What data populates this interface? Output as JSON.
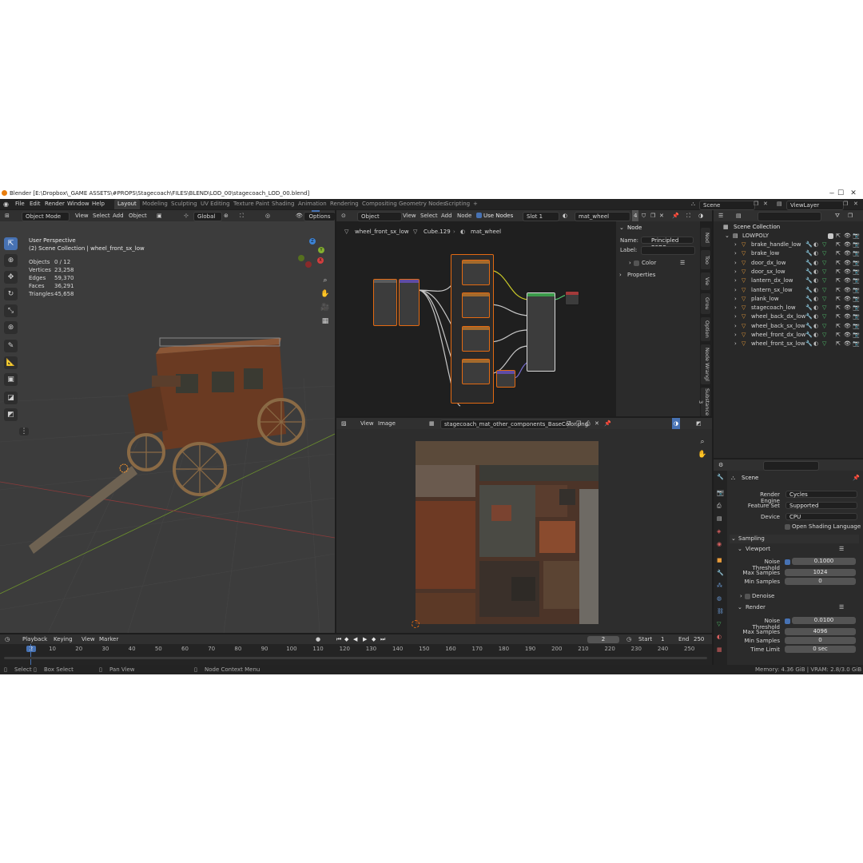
{
  "window": {
    "title": "Blender [E:\\Dropbox\\_GAME ASSETS\\#PROPS\\Stagecoach\\FILES\\BLEND\\LOD_00\\stagecoach_LOD_00.blend]",
    "minimize": "–",
    "maximize": "☐",
    "close": "✕"
  },
  "menu": {
    "items": [
      "File",
      "Edit",
      "Render",
      "Window",
      "Help"
    ],
    "workspaces": [
      "Layout",
      "Modeling",
      "Sculpting",
      "UV Editing",
      "Texture Paint",
      "Shading",
      "Animation",
      "Rendering",
      "Compositing",
      "Geometry Nodes",
      "Scripting"
    ],
    "active_workspace": "Layout",
    "add_workspace": "+",
    "scene": "Scene",
    "view_layer": "ViewLayer"
  },
  "viewport": {
    "mode": "Object Mode",
    "menus": [
      "View",
      "Select",
      "Add",
      "Object"
    ],
    "transform": "Global",
    "options": "Options",
    "view_name": "User Perspective",
    "collection_path": "(2) Scene Collection | wheel_front_sx_low",
    "stats": [
      {
        "label": "Objects",
        "value": "0 / 12"
      },
      {
        "label": "Vertices",
        "value": "23,258"
      },
      {
        "label": "Edges",
        "value": "59,370"
      },
      {
        "label": "Faces",
        "value": "36,291"
      },
      {
        "label": "Triangles",
        "value": "45,658"
      }
    ],
    "gizmo": {
      "x": "X",
      "y": "Y",
      "z": "Z"
    }
  },
  "node_editor": {
    "object_dropdown": "Object",
    "menus": [
      "View",
      "Select",
      "Add",
      "Node"
    ],
    "use_nodes": "Use Nodes",
    "slot": "Slot 1",
    "material": "mat_wheel",
    "user_count": "4",
    "breadcrumbs": [
      "wheel_front_sx_low",
      "Cube.129",
      "mat_wheel"
    ],
    "sidebar": {
      "panel": "Node",
      "name_label": "Name:",
      "name_value": "Principled BSDF",
      "label_label": "Label:",
      "label_value": "",
      "color": "Color",
      "properties": "Properties"
    },
    "vtabs": [
      "Nod",
      "Too",
      "Vie",
      "Grou",
      "Option",
      "Node Wrangl",
      "Substance 3"
    ]
  },
  "image_editor": {
    "menus": [
      "View",
      "Image"
    ],
    "image_name": "stagecoach_mat_other_components_BaseColor.png"
  },
  "outliner": {
    "root": "Scene Collection",
    "collection": "LOWPOLY",
    "items": [
      "brake_handle_low",
      "brake_low",
      "door_dx_low",
      "door_sx_low",
      "lantern_dx_low",
      "lantern_sx_low",
      "plank_low",
      "stagecoach_low",
      "wheel_back_dx_low",
      "wheel_back_sx_low",
      "wheel_front_dx_low",
      "wheel_front_sx_low"
    ]
  },
  "properties": {
    "scene": "Scene",
    "render_engine_label": "Render Engine",
    "render_engine": "Cycles",
    "feature_set_label": "Feature Set",
    "feature_set": "Supported",
    "device_label": "Device",
    "device": "CPU",
    "osl": "Open Shading Language",
    "sampling": "Sampling",
    "viewport": "Viewport",
    "vp_noise_label": "Noise Threshold",
    "vp_noise": "0.1000",
    "vp_max_label": "Max Samples",
    "vp_max": "1024",
    "vp_min_label": "Min Samples",
    "vp_min": "0",
    "denoise": "Denoise",
    "render": "Render",
    "r_noise_label": "Noise Threshold",
    "r_noise": "0.0100",
    "r_max_label": "Max Samples",
    "r_max": "4096",
    "r_min_label": "Min Samples",
    "r_min": "0",
    "time_limit_label": "Time Limit",
    "time_limit": "0 sec"
  },
  "timeline": {
    "menus": [
      "Playback",
      "Keying",
      "View",
      "Marker"
    ],
    "current_frame": "2",
    "start_label": "Start",
    "start": "1",
    "end_label": "End",
    "end": "250",
    "ticks": [
      "2",
      "10",
      "20",
      "30",
      "40",
      "50",
      "60",
      "70",
      "80",
      "90",
      "100",
      "110",
      "120",
      "130",
      "140",
      "150",
      "160",
      "170",
      "180",
      "190",
      "200",
      "210",
      "220",
      "230",
      "240",
      "250"
    ]
  },
  "statusbar": {
    "select": "Select",
    "box_select": "Box Select",
    "pan_view": "Pan View",
    "node_context": "Node Context Menu",
    "memory": "Memory: 4.36 GiB | VRAM: 2.8/3.0 GiB | 3.1.0"
  },
  "colors": {
    "accent": "#4772b3",
    "orange": "#e36a12",
    "bg": "#1d1d1d",
    "panel": "#2b2b2b"
  }
}
